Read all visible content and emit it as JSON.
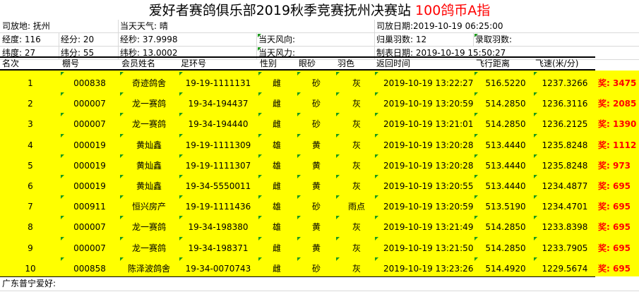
{
  "title": {
    "main": "爱好者赛鸽俱乐部2019秋季竞赛抚州决赛站",
    "accent": "100鸽币A指"
  },
  "info": {
    "row1": {
      "release_place_label": "司放地: 抚州",
      "weather": "当天天气: 晴",
      "release_date": "司放日期:2019-10-19 06:25:00"
    },
    "row2": {
      "lon_deg": "经度: 116",
      "lon_min": "经分: 20",
      "lon_sec": "经秒: 37.9998",
      "wind_dir": "当天风向:",
      "return_count": "归巢羽数: 12",
      "recorded_count": "录取羽数:"
    },
    "row3": {
      "lat_deg": "纬度:  27",
      "lat_min": "纬分: 55",
      "lat_sec": "纬秒: 13.0002",
      "wind_force": "当天风力:",
      "made_date": "制表日期: 2019-10-19 15:50:27"
    }
  },
  "table": {
    "headers": [
      "名次",
      "棚号",
      "会员姓名",
      "足环号",
      "性别",
      "眼砂",
      "羽色",
      "返回时间",
      "飞行距离",
      "飞速(米/分)"
    ],
    "rows": [
      {
        "rank": "1",
        "loft": "000838",
        "name": "奇迹鸽舍",
        "ring": "19-19-1111131",
        "sex": "雌",
        "eye": "砂",
        "color": "灰",
        "time": "2019-10-19 13:22:27",
        "dist": "516.5220",
        "speed": "1237.3266",
        "prize": "奖: 3475"
      },
      {
        "rank": "2",
        "loft": "000007",
        "name": "龙一赛鸽",
        "ring": "19-34-194437",
        "sex": "雌",
        "eye": "砂",
        "color": "灰",
        "time": "2019-10-19 13:20:59",
        "dist": "514.2850",
        "speed": "1236.3116",
        "prize": "奖: 2085"
      },
      {
        "rank": "3",
        "loft": "000007",
        "name": "龙一赛鸽",
        "ring": "19-34-194440",
        "sex": "雌",
        "eye": "砂",
        "color": "灰",
        "time": "2019-10-19 13:21:01",
        "dist": "514.2850",
        "speed": "1236.2125",
        "prize": "奖: 1390"
      },
      {
        "rank": "4",
        "loft": "000019",
        "name": "黄灿鑫",
        "ring": "19-19-1111309",
        "sex": "雄",
        "eye": "黄",
        "color": "灰",
        "time": "2019-10-19 13:20:28",
        "dist": "513.4440",
        "speed": "1235.8248",
        "prize": "奖: 1112"
      },
      {
        "rank": "5",
        "loft": "000019",
        "name": "黄灿鑫",
        "ring": "19-19-1111307",
        "sex": "雄",
        "eye": "黄",
        "color": "灰",
        "time": "2019-10-19 13:20:28",
        "dist": "513.4440",
        "speed": "1235.8248",
        "prize": "奖: 973"
      },
      {
        "rank": "6",
        "loft": "000019",
        "name": "黄灿鑫",
        "ring": "19-34-5550011",
        "sex": "雌",
        "eye": "黄",
        "color": "灰",
        "time": "2019-10-19 13:20:55",
        "dist": "513.4440",
        "speed": "1234.4877",
        "prize": "奖: 695"
      },
      {
        "rank": "7",
        "loft": "000911",
        "name": "恒兴房产",
        "ring": "19-19-1111436",
        "sex": "雄",
        "eye": "砂",
        "color": "雨点",
        "time": "2019-10-19 13:20:59",
        "dist": "513.5190",
        "speed": "1234.4701",
        "prize": "奖: 695"
      },
      {
        "rank": "8",
        "loft": "000007",
        "name": "龙一赛鸽",
        "ring": "19-34-198380",
        "sex": "雄",
        "eye": "黄",
        "color": "灰",
        "time": "2019-10-19 13:21:49",
        "dist": "514.2850",
        "speed": "1233.8398",
        "prize": "奖: 695"
      },
      {
        "rank": "9",
        "loft": "000007",
        "name": "龙一赛鸽",
        "ring": "19-34-198371",
        "sex": "雌",
        "eye": "黄",
        "color": "灰",
        "time": "2019-10-19 13:21:50",
        "dist": "514.2850",
        "speed": "1233.7905",
        "prize": "奖: 695"
      },
      {
        "rank": "10",
        "loft": "000858",
        "name": "陈泽波鸽舍",
        "ring": "19-34-0070743",
        "sex": "雌",
        "eye": "砂",
        "color": "灰",
        "time": "2019-10-19 13:23:26",
        "dist": "514.4920",
        "speed": "1229.5674",
        "prize": "奖: 695"
      }
    ]
  },
  "footer": {
    "text": "广东普宁爱好:"
  },
  "colors": {
    "highlight": "#ffff00",
    "accent": "#ff0000",
    "marker": "#1a9a1a"
  }
}
